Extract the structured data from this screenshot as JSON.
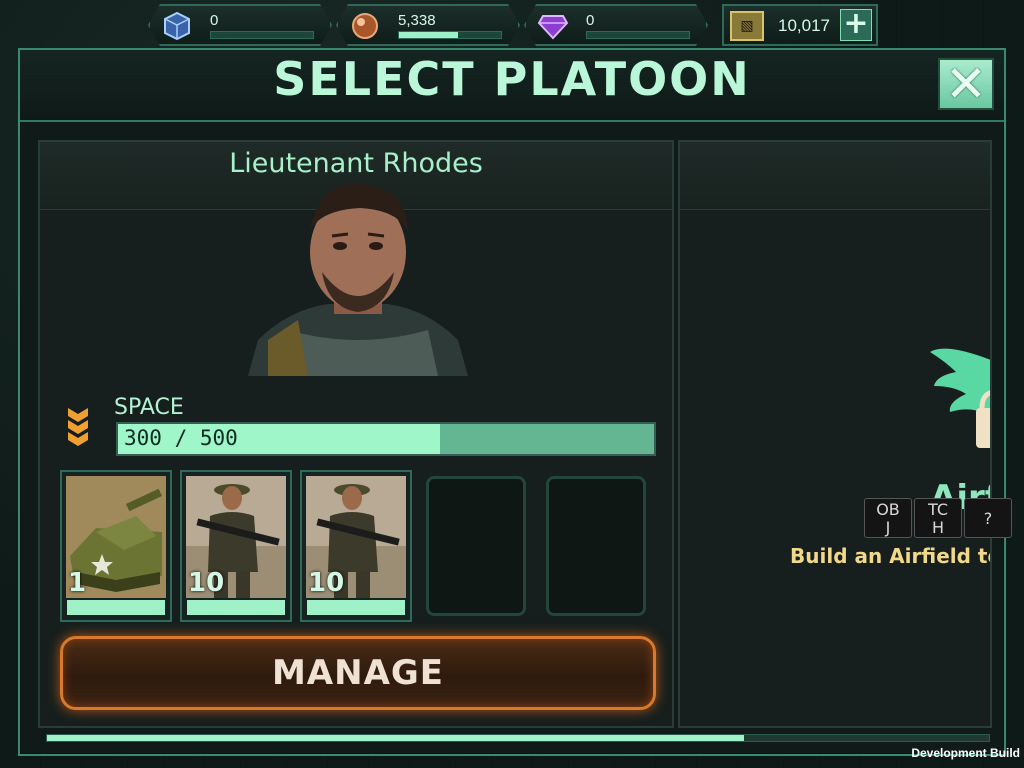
{
  "resources": [
    {
      "name": "cube",
      "icon": "cube-icon",
      "value": "0",
      "fill": 0
    },
    {
      "name": "ore",
      "icon": "ore-orb-icon",
      "value": "5,338",
      "fill": 0.58
    },
    {
      "name": "gem",
      "icon": "purple-gem-icon",
      "value": "0",
      "fill": 0
    }
  ],
  "gold": {
    "icon": "gold-bars-icon",
    "value": "10,017",
    "plus_label": "+"
  },
  "window": {
    "title": "SELECT PLATOON",
    "close_label": "✕"
  },
  "platoon": {
    "commander": "Lieutenant Rhodes",
    "space_label": "SPACE",
    "space_text": "300 / 500",
    "space_fraction": 0.6,
    "units": [
      {
        "type": "tank",
        "count": "1"
      },
      {
        "type": "rifleman",
        "count": "10"
      },
      {
        "type": "rifleman",
        "count": "10"
      }
    ],
    "empty_slots": 2,
    "manage_label": "MANAGE"
  },
  "airfield": {
    "title": "Airfi",
    "hint": "Build an Airfield to"
  },
  "keys": [
    {
      "top": "OB",
      "bottom": "J"
    },
    {
      "top": "TC",
      "bottom": "H"
    },
    {
      "top": "?",
      "bottom": ""
    }
  ],
  "progress_fraction": 0.74,
  "footer": {
    "build_label": "Development Build"
  },
  "colors": {
    "accent": "#9ff2c8",
    "border": "#2f6a58",
    "manage": "#d8792c",
    "hint": "#f1d88a"
  }
}
